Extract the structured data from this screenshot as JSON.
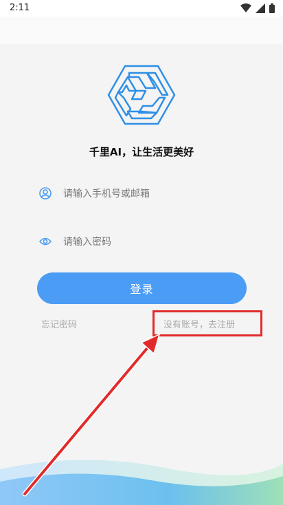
{
  "status_bar": {
    "time": "2:11"
  },
  "slogan": "千里AI，让生活更美好",
  "username_field": {
    "placeholder": "请输入手机号或邮箱",
    "icon": "user-circle-icon"
  },
  "password_field": {
    "placeholder": "请输入密码",
    "icon": "eye-icon"
  },
  "login_button": {
    "label": "登录"
  },
  "forgot_password": "忘记密码",
  "register_link": "没有账号，去注册",
  "colors": {
    "accent": "#4b9cf4",
    "highlight_box": "#e12b2b",
    "arrow": "#e12b2b",
    "logo_stroke": "#2f8fe6"
  }
}
